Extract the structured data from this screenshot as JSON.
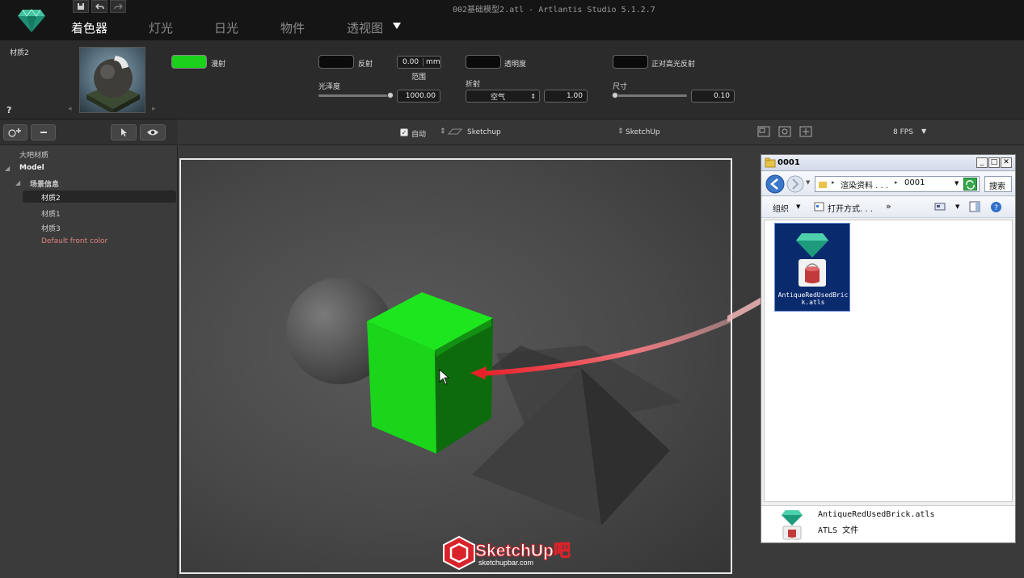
{
  "window": {
    "title": "002基础模型2.atl - Artlantis Studio 5.1.2.7"
  },
  "main_tabs": [
    {
      "label": "着色器"
    },
    {
      "label": "灯光"
    },
    {
      "label": "日光"
    },
    {
      "label": "物件"
    },
    {
      "label": "透视图"
    }
  ],
  "material_panel": {
    "material_name": "材质2",
    "help": "?",
    "diffuse_label": "漫射",
    "diffuse_color": "#1bd11b",
    "reflection_label": "反射",
    "range_value": "0.00",
    "range_unit": "mm",
    "range_label": "范围",
    "gloss_label": "光泽度",
    "gloss_value": "1000.00",
    "transparency_label": "透明度",
    "refraction_label": "折射",
    "refraction_medium": "空气",
    "refraction_value": "1.00",
    "fresnel_label": "正对高光反射",
    "size_label": "尺寸",
    "size_value": "0.10"
  },
  "left_panel": {
    "tree": [
      {
        "label": "大吧材质",
        "level": 0
      },
      {
        "label": "Model",
        "level": 0
      },
      {
        "label": "场景信息",
        "level": 1
      },
      {
        "label": "材质2",
        "level": 2,
        "selected": true
      },
      {
        "label": "材质1",
        "level": 2
      },
      {
        "label": "材质3",
        "level": 2
      },
      {
        "label": "Default front color",
        "level": 2
      }
    ]
  },
  "viewport_header": {
    "auto_label": "自动",
    "auto_checked": true,
    "source_label": "Sketchup",
    "sync_label": "SketchUp",
    "fps_label": "8 FPS"
  },
  "explorer": {
    "title": "0001",
    "path_parent": "渲染资料 . . .",
    "path_current": "0001",
    "search_label": "搜索",
    "organize_label": "组织",
    "open_with_label": "打开方式. . .",
    "more_label": "»",
    "file_name": "AntiqueRedUsedBrick.atls",
    "file_name_wrapped": "AntiqueRedUsedBrick.atls",
    "details_name": "AntiqueRedUsedBrick.atls",
    "details_type": "ATLS 文件"
  },
  "watermark": {
    "brand": "SketchUp吧",
    "url": "sketchupbar.com"
  },
  "colors": {
    "accent_green": "#1bd11b",
    "drag_arrow": "#e8202a"
  }
}
